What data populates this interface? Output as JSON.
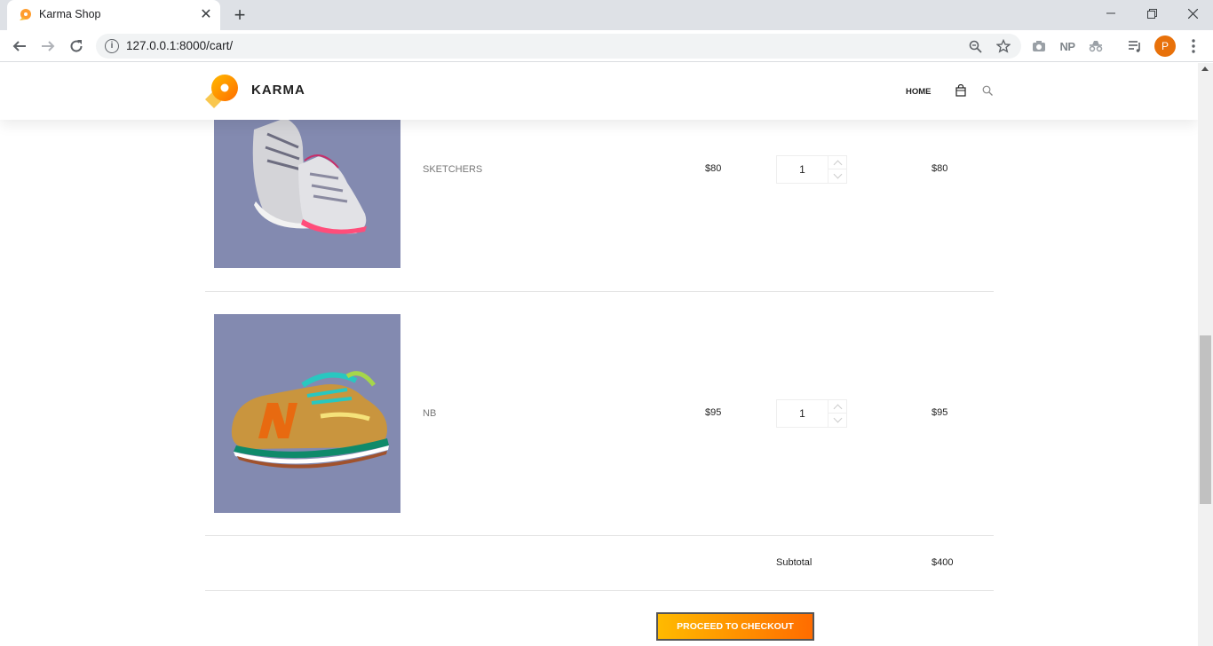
{
  "browser": {
    "tab_title": "Karma Shop",
    "tab_close": "✕",
    "new_tab": "+",
    "url": "127.0.0.1:8000/cart/",
    "avatar_letter": "P",
    "np_label": "NP"
  },
  "site": {
    "logo_text": "KARMA",
    "nav_home": "HOME"
  },
  "cart": {
    "items": [
      {
        "name": "SKETCHERS",
        "price": "$80",
        "quantity": "1",
        "total": "$80"
      },
      {
        "name": "NB",
        "price": "$95",
        "quantity": "1",
        "total": "$95"
      }
    ],
    "subtotal_label": "Subtotal",
    "subtotal_value": "$400",
    "checkout_label": "PROCEED TO CHECKOUT"
  },
  "colors": {
    "accent_start": "#ffba00",
    "accent_end": "#ff6c00",
    "product_bg": "#838ab0"
  }
}
